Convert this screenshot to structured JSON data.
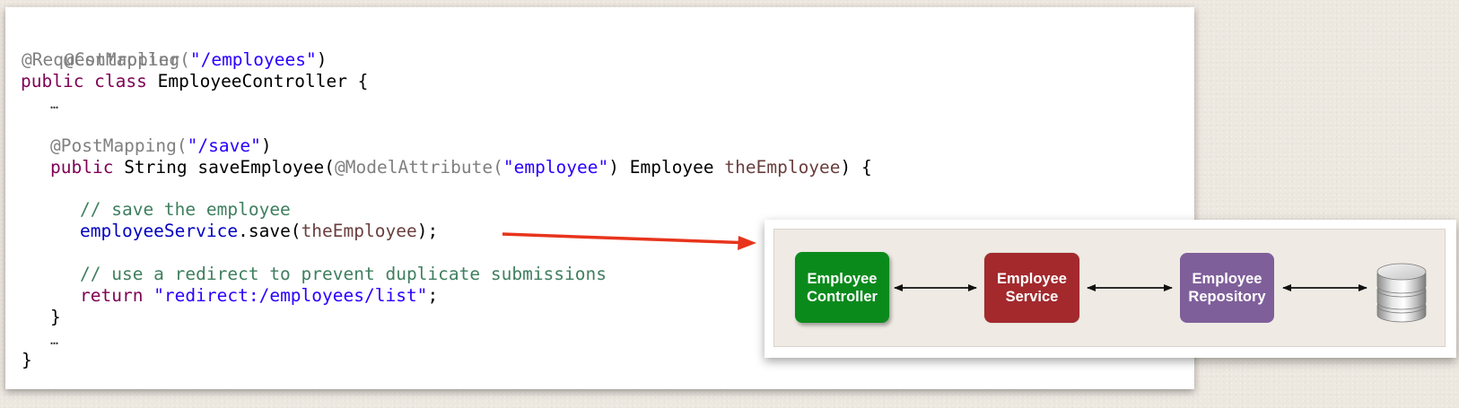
{
  "code": {
    "lines": {
      "l1": "@Controller",
      "l2_annot": "@RequestMapping(",
      "l2_str": "\"/employees\"",
      "l2_end": ")",
      "l3_kw": "public class ",
      "l3_plain": "EmployeeController {",
      "l4": "…",
      "l6_annot": "@PostMapping(",
      "l6_str": "\"/save\"",
      "l6_end": ")",
      "l7_kw": "public ",
      "l7_plain1": "String saveEmployee(",
      "l7_annot": "@ModelAttribute(",
      "l7_str": "\"employee\"",
      "l7_plain2": ") Employee ",
      "l7_param": "theEmployee",
      "l7_end": ") {",
      "l9_comment": "// save the employee",
      "l10_field": "employeeService",
      "l10_plain1": ".save(",
      "l10_param": "theEmployee",
      "l10_end": ");",
      "l12_comment": "// use a redirect to prevent duplicate submissions",
      "l13_kw": "return ",
      "l13_str": "\"redirect:/employees/list\"",
      "l13_end": ";",
      "l14": "}",
      "l15": "…",
      "l16": "}"
    }
  },
  "diagram": {
    "boxes": {
      "controller": "Employee\nController",
      "service": "Employee\nService",
      "repository": "Employee\nRepository"
    },
    "icon": "database-icon"
  },
  "colors": {
    "annotation": "#808080",
    "string": "#2a00ff",
    "keyword": "#7f0055",
    "comment": "#3f7f5f",
    "field": "#0000c0",
    "param": "#6a3e3e",
    "controller": "#0b8a1c",
    "service": "#a3292d",
    "repository": "#7f5f9a",
    "arrow": "#e8341c"
  }
}
